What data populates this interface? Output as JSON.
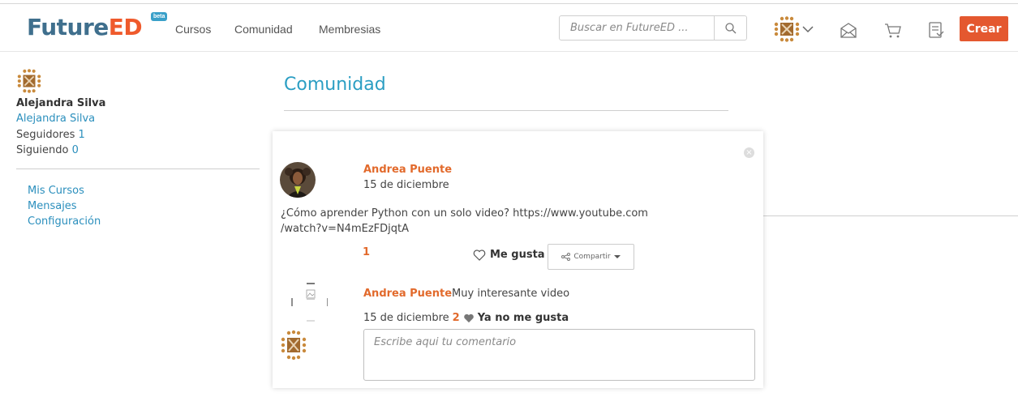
{
  "brand": {
    "name_main": "Future",
    "name_accent": "ED",
    "badge": "beta"
  },
  "nav": {
    "links": [
      "Cursos",
      "Comunidad",
      "Membresias"
    ]
  },
  "search": {
    "placeholder": "Buscar en FutureED ..."
  },
  "header": {
    "create_label": "Crear"
  },
  "sidebar": {
    "name": "Alejandra Silva",
    "username": "Alejandra Silva",
    "followers_label": "Seguidores",
    "followers_count": "1",
    "following_label": "Siguiendo",
    "following_count": "0",
    "menu": [
      "Mis Cursos",
      "Mensajes",
      "Configuración"
    ]
  },
  "main": {
    "title": "Comunidad"
  },
  "post": {
    "author": "Andrea Puente",
    "date": "15 de diciembre",
    "text_line1": "¿Cómo aprender Python con un solo video? https://www.youtube.com",
    "text_line2": "/watch?v=N4mEzFDjqtA",
    "likes": "1",
    "like_label": "Me gusta",
    "share_label": "Compartir",
    "close_label": "×"
  },
  "comment": {
    "author": "Andrea Puente",
    "text": "Muy interesante video",
    "date": "15 de diciembre",
    "likes": "2",
    "unlike_label": "Ya no me gusta"
  },
  "composer": {
    "placeholder": "Escribe aqui tu comentario"
  },
  "colors": {
    "accent": "#e4582f",
    "link": "#2b8fbd",
    "title": "#2b9ec3",
    "author": "#e26a2c",
    "brand": "#3f6f8d"
  },
  "icons": [
    "search-icon",
    "user-avatar-icon",
    "chevron-down-icon",
    "envelope-icon",
    "cart-icon",
    "certificate-icon",
    "heart-outline-icon",
    "share-icon",
    "heart-filled-icon",
    "close-icon",
    "broken-image-icon"
  ]
}
